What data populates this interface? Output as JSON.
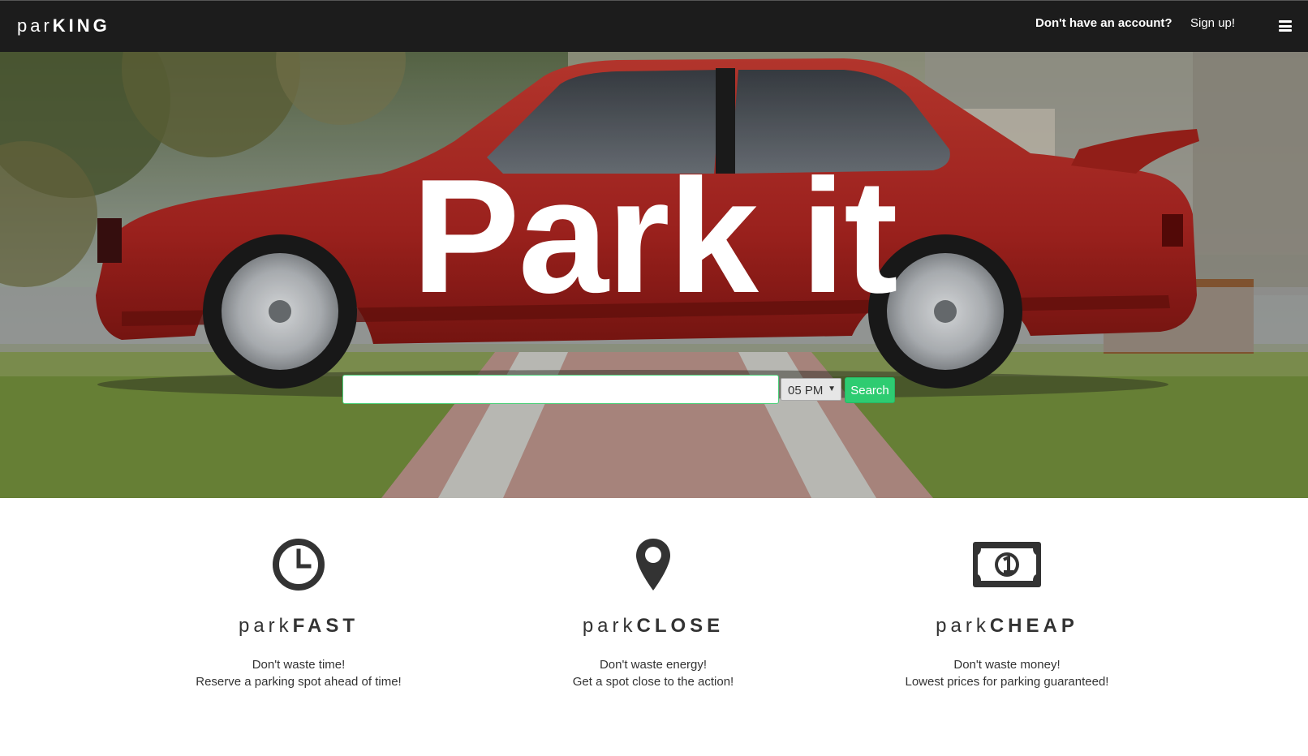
{
  "navbar": {
    "brand_light": "par",
    "brand_bold": "KING",
    "question": "Don't have an account?",
    "signup": "Sign up!",
    "menu_icon": "hamburger-menu-icon"
  },
  "hero": {
    "title": "Park it",
    "search": {
      "value": "",
      "placeholder": ""
    },
    "time_select": {
      "selected": "05 PM"
    },
    "search_button": "Search"
  },
  "features": [
    {
      "icon": "clock-icon",
      "title_light": "park",
      "title_bold": "FAST",
      "line1": "Don't waste time!",
      "line2": "Reserve a parking spot ahead of time!"
    },
    {
      "icon": "map-marker-icon",
      "title_light": "park",
      "title_bold": "CLOSE",
      "line1": "Don't waste energy!",
      "line2": "Get a spot close to the action!"
    },
    {
      "icon": "money-bill-icon",
      "title_light": "park",
      "title_bold": "CHEAP",
      "line1": "Don't waste money!",
      "line2": "Lowest prices for parking guaranteed!"
    }
  ],
  "colors": {
    "navbar": "#1c1c1c",
    "accent": "#2ecc71",
    "car": "#b52a22",
    "icon": "#333333"
  }
}
